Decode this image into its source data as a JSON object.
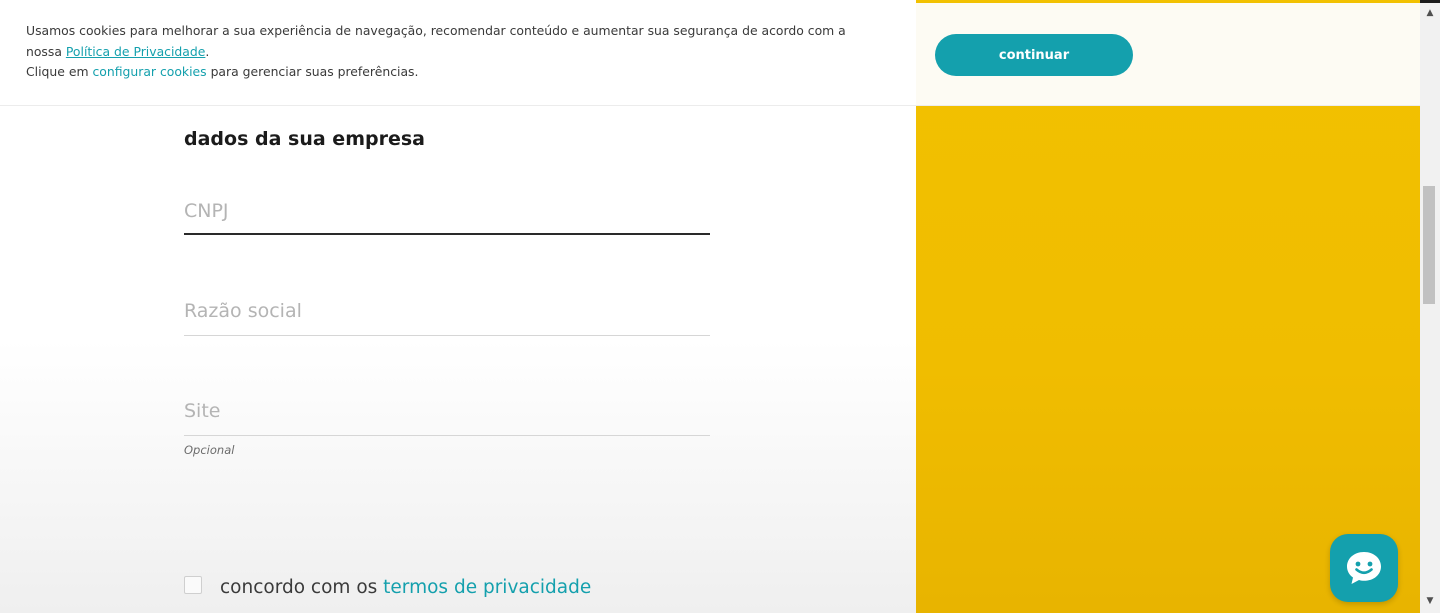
{
  "cookie_banner": {
    "text_line1": "Usamos cookies para melhorar a sua experiência de navegação, recomendar conteúdo e aumentar sua segurança de acordo com a",
    "text_prefix_line2": "nossa ",
    "privacy_link": "Política de Privacidade",
    "text_suffix_line2": ".",
    "text_prefix_line3": "Clique em ",
    "configure_link": "configurar cookies",
    "text_suffix_line3": " para gerenciar suas preferências.",
    "continue_label": "continuar"
  },
  "form": {
    "title": "dados da sua empresa",
    "fields": [
      {
        "placeholder": "CNPJ",
        "value": ""
      },
      {
        "placeholder": "Razão social",
        "value": ""
      },
      {
        "placeholder": "Site",
        "value": "",
        "hint": "Opcional"
      }
    ],
    "agree_prefix": "concordo com os ",
    "terms_link": "termos de privacidade",
    "agree_checked": false
  },
  "scrollbar": {
    "up_arrow": "▲",
    "down_arrow": "▼"
  },
  "chat": {
    "icon": "chat-bubble-smiley-icon"
  },
  "colors": {
    "accent": "#14a0ad",
    "panel_yellow": "#f2c100",
    "title_text": "#1b1b1b",
    "placeholder_text": "#b4b4b4"
  }
}
